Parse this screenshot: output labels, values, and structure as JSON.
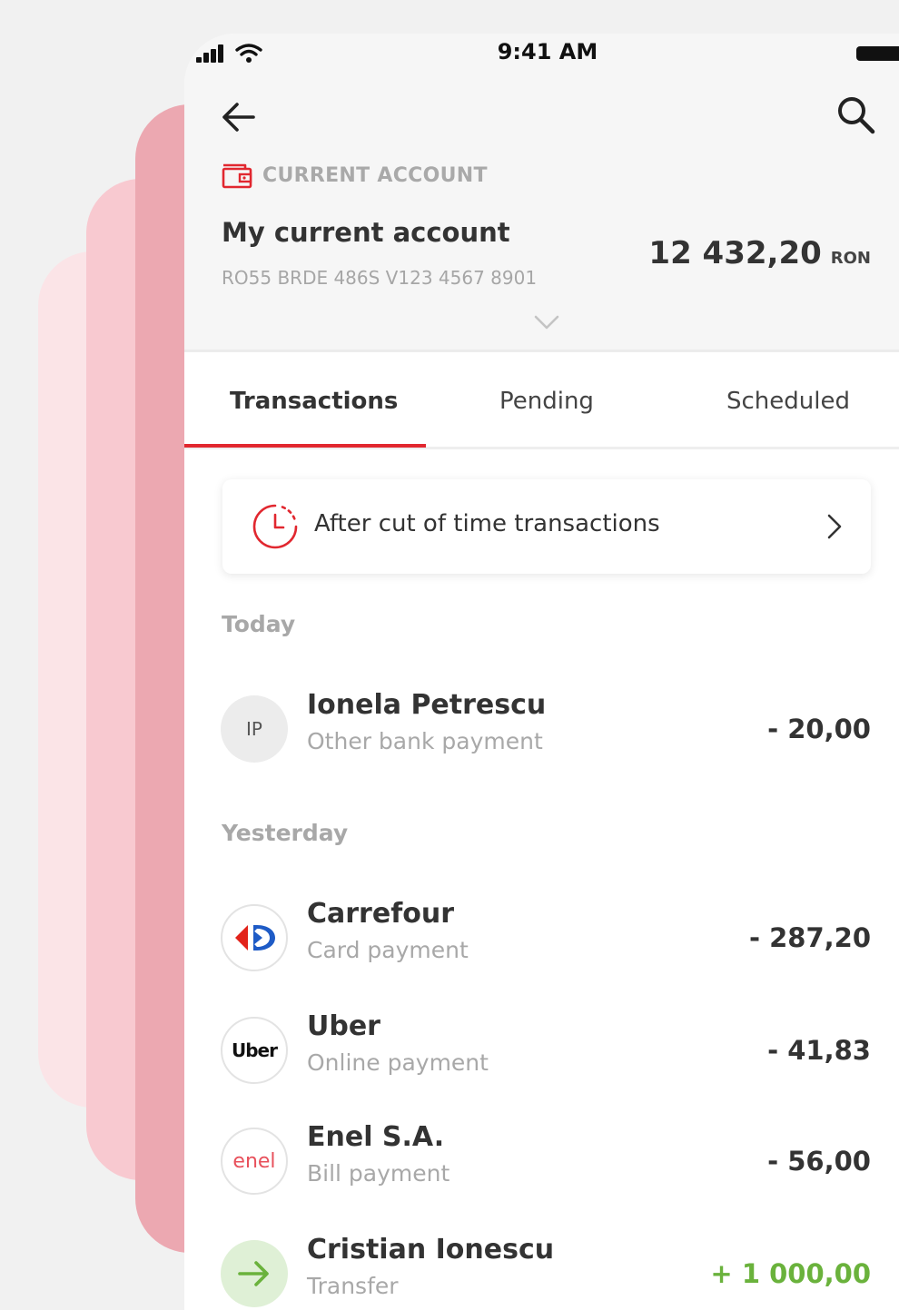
{
  "status_bar": {
    "time": "9:41 AM"
  },
  "account": {
    "type_label": "CURRENT ACCOUNT",
    "name": "My current account",
    "iban": "RO55 BRDE 486S V123 4567 8901",
    "balance": "12 432,20",
    "currency": "RON"
  },
  "tabs": [
    {
      "label": "Transactions",
      "active": true
    },
    {
      "label": "Pending",
      "active": false
    },
    {
      "label": "Scheduled",
      "active": false
    }
  ],
  "cutoff": {
    "label": "After cut of time transactions"
  },
  "sections": {
    "today": "Today",
    "yesterday": "Yesterday"
  },
  "transactions": [
    {
      "initials": "IP",
      "name": "Ionela Petrescu",
      "type": "Other bank payment",
      "amount": "- 20,00",
      "icon": "initials-avatar"
    },
    {
      "logo": "carrefour-logo",
      "name": "Carrefour",
      "type": "Card payment",
      "amount": "- 287,20",
      "icon": "carrefour-logo"
    },
    {
      "logo_text": "Uber",
      "name": "Uber",
      "type": "Online payment",
      "amount": "- 41,83",
      "icon": "uber-logo"
    },
    {
      "logo_text": "enel",
      "name": "Enel S.A.",
      "type": "Bill payment",
      "amount": "- 56,00",
      "icon": "enel-logo"
    },
    {
      "name": "Cristian Ionescu",
      "type": "Transfer",
      "amount": "+ 1 000,00",
      "icon": "arrow-right-icon"
    }
  ],
  "colors": {
    "accent_red": "#e1272f",
    "positive_green": "#6ab23c",
    "back_card_1": "#eca8b1",
    "back_card_2": "#f8c9d0",
    "back_card_3": "#fbe4e7"
  }
}
